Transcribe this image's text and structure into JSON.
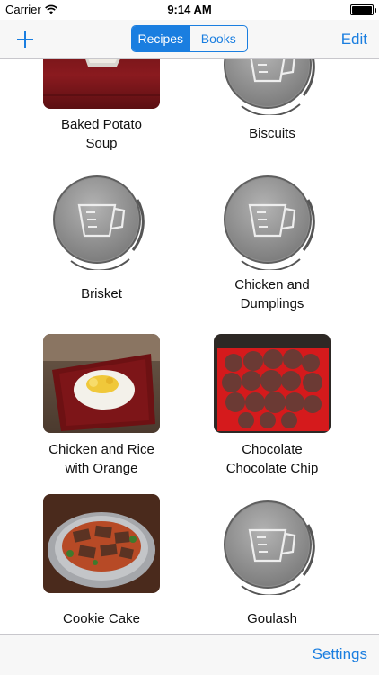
{
  "status": {
    "carrier": "Carrier",
    "time": "9:14 AM"
  },
  "nav": {
    "segments": [
      "Recipes",
      "Books"
    ],
    "selected": "Recipes",
    "edit_label": "Edit"
  },
  "recipes": [
    {
      "name": "Baked Potato Soup",
      "line1": "Baked Potato",
      "line2": "Soup",
      "image": "photo"
    },
    {
      "name": "Biscuits",
      "line1": "Biscuits",
      "line2": "",
      "image": "placeholder"
    },
    {
      "name": "Brisket",
      "line1": "Brisket",
      "line2": "",
      "image": "placeholder"
    },
    {
      "name": "Chicken and Dumplings",
      "line1": "Chicken and",
      "line2": "Dumplings",
      "image": "placeholder"
    },
    {
      "name": "Chicken and Rice with Orange",
      "line1": "Chicken and Rice",
      "line2": "with Orange",
      "image": "photo"
    },
    {
      "name": "Chocolate Chocolate Chip",
      "line1": "Chocolate",
      "line2": "Chocolate Chip",
      "image": "photo"
    },
    {
      "name": "Cookie Cake",
      "line1": "Cookie Cake",
      "line2": "",
      "image": "photo"
    },
    {
      "name": "Goulash",
      "line1": "Goulash",
      "line2": "",
      "image": "placeholder"
    }
  ],
  "tabbar": {
    "settings_label": "Settings"
  },
  "colors": {
    "accent": "#1a7ee0",
    "bar_background": "#f7f7f7"
  }
}
